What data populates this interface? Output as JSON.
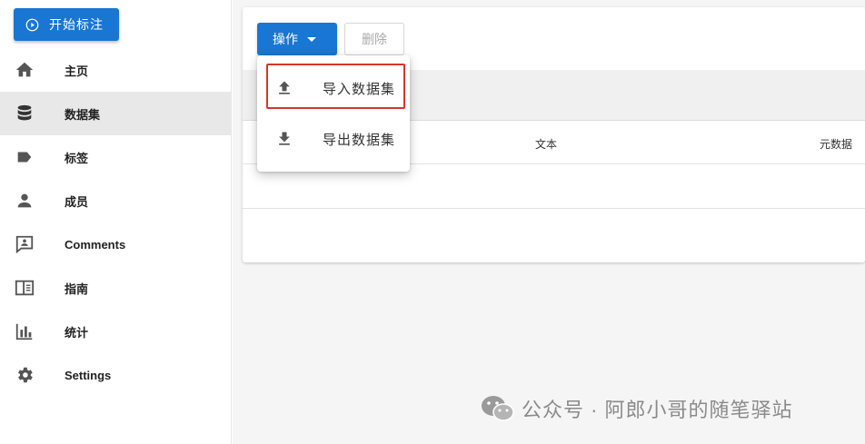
{
  "sidebar": {
    "start_button": "开始标注",
    "items": [
      {
        "label": "主页",
        "icon": "home-icon"
      },
      {
        "label": "数据集",
        "icon": "database-icon",
        "active": true
      },
      {
        "label": "标签",
        "icon": "label-icon"
      },
      {
        "label": "成员",
        "icon": "person-icon"
      },
      {
        "label": "Comments",
        "icon": "comment-icon"
      },
      {
        "label": "指南",
        "icon": "book-icon"
      },
      {
        "label": "统计",
        "icon": "bar-chart-icon"
      },
      {
        "label": "Settings",
        "icon": "gear-icon"
      }
    ]
  },
  "toolbar": {
    "ops_label": "操作",
    "delete_label": "删除"
  },
  "dropdown": {
    "items": [
      {
        "label": "导入数据集",
        "icon": "upload-icon"
      },
      {
        "label": "导出数据集",
        "icon": "download-icon"
      }
    ]
  },
  "table": {
    "columns": [
      "文本",
      "元数据"
    ]
  },
  "watermark": {
    "text": "公众号 · 阿郎小哥的随笔驿站"
  },
  "colors": {
    "primary": "#1976d2",
    "highlight": "#d9332b"
  }
}
